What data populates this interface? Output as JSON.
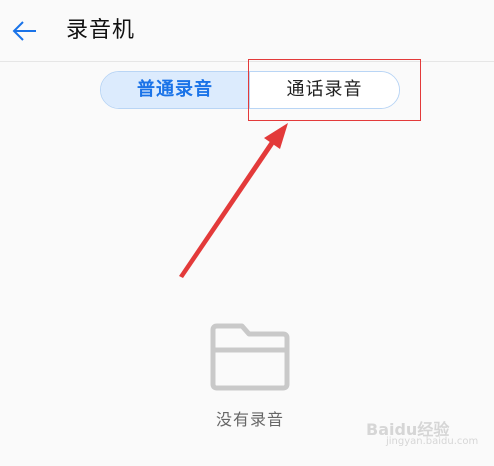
{
  "header": {
    "back_icon": "arrow-left-icon",
    "title": "录音机"
  },
  "tabs": [
    {
      "label": "普通录音",
      "active": true
    },
    {
      "label": "通话录音",
      "active": false
    }
  ],
  "empty_state": {
    "icon": "folder-icon",
    "text": "没有录音"
  },
  "annotation": {
    "box_color": "#e33a3a",
    "arrow_color": "#e33a3a"
  },
  "watermark": {
    "text": "Baidu经验",
    "sub_text": "jingyan.baidu.com"
  },
  "colors": {
    "accent": "#1a73e8",
    "tab_active_bg": "#dcebfd",
    "background": "#fafafa"
  }
}
